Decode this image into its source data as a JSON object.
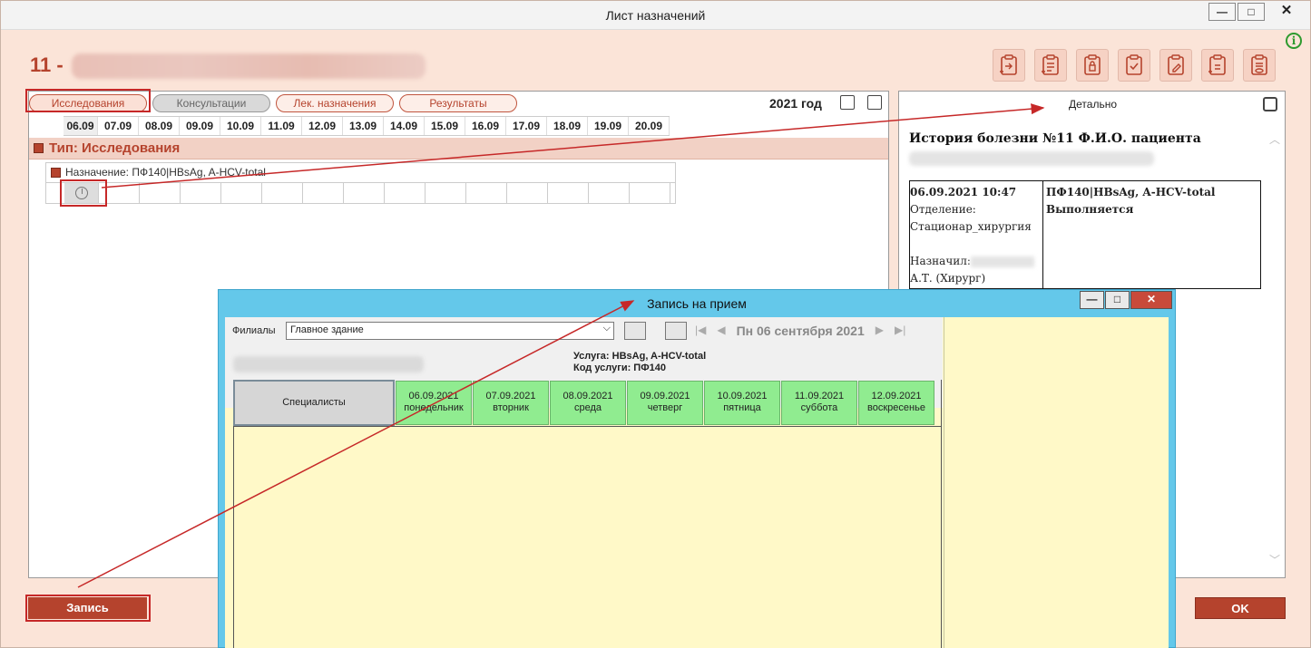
{
  "window": {
    "title": "Лист назначений",
    "minimize": "—",
    "maximize": "□",
    "close": "✕"
  },
  "patient": {
    "number": "11 -"
  },
  "tabs": [
    {
      "label": "Исследования"
    },
    {
      "label": "Консультации"
    },
    {
      "label": "Лек. назначения"
    },
    {
      "label": "Результаты"
    }
  ],
  "year": "2021 год",
  "dates": [
    "06.09",
    "07.09",
    "08.09",
    "09.09",
    "10.09",
    "11.09",
    "12.09",
    "13.09",
    "14.09",
    "15.09",
    "16.09",
    "17.09",
    "18.09",
    "19.09",
    "20.09"
  ],
  "group": {
    "type_label": "Тип: Исследования",
    "assignment_label": "Назначение: ПФ140|HBsAg, A-HCV-total"
  },
  "detail": {
    "title": "Детально",
    "header": "История болезни №11 Ф.И.О. пациента",
    "datetime": "06.09.2021 10:47",
    "department_label": "Отделение:",
    "department": "Стационар_хирургия",
    "assigned_label": "Назначил:",
    "doctor": "А.Т. (Хирург)",
    "service": "ПФ140|HBsAg, A-HCV-total",
    "status": "Выполняется"
  },
  "buttons": {
    "record": "Запись",
    "ok": "OK"
  },
  "dialog": {
    "title": "Запись на прием",
    "filial_label": "Филиалы",
    "filial_value": "Главное здание",
    "date_nav": "Пн 06 сентября 2021",
    "service_line": "Услуга: HBsAg, A-HCV-total",
    "service_code_line": "Код услуги: ПФ140",
    "specialists_header": "Специалисты",
    "days": [
      {
        "date": "06.09.2021",
        "weekday": "понедельник"
      },
      {
        "date": "07.09.2021",
        "weekday": "вторник"
      },
      {
        "date": "08.09.2021",
        "weekday": "среда"
      },
      {
        "date": "09.09.2021",
        "weekday": "четверг"
      },
      {
        "date": "10.09.2021",
        "weekday": "пятница"
      },
      {
        "date": "11.09.2021",
        "weekday": "суббота"
      },
      {
        "date": "12.09.2021",
        "weekday": "воскресенье"
      }
    ],
    "minimize": "—",
    "maximize": "□",
    "close": "✕"
  },
  "colors": {
    "accent": "#b5432d",
    "window_bg": "#fbe4d8",
    "dialog_frame": "#64c8ea",
    "calendar_bg": "#fff9c8",
    "day_header": "#90ec90",
    "annotation": "#c62828"
  },
  "icons": [
    "info-icon",
    "clipboard-icon",
    "copy-icon",
    "calendar-icon",
    "print-icon",
    "clock-icon",
    "edit-icon",
    "image-icon"
  ]
}
